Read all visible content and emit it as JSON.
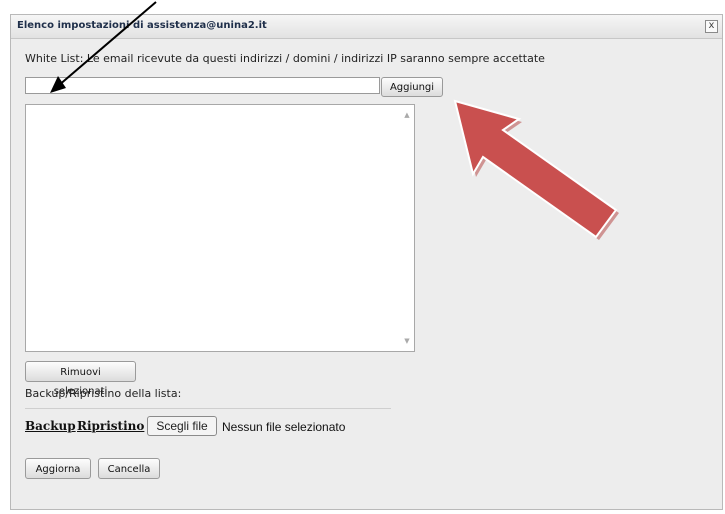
{
  "dialog": {
    "title": "Elenco impostazioni di assistenza@unina2.it",
    "close_label": "x"
  },
  "whitelist": {
    "description": "White List: Le email ricevute da questi indirizzi / domini / indirizzi IP saranno sempre accettate",
    "input_value": "",
    "add_label": "Aggiungi"
  },
  "list": {
    "items": []
  },
  "remove_label": "Rimuovi selezionati",
  "backup": {
    "title": "Backup/Ripristino della lista:",
    "backup_link": "Backup",
    "restore_link": "Ripristino",
    "choose_file_label": "Scegli file",
    "file_status": "Nessun file selezionato"
  },
  "footer": {
    "update_label": "Aggiorna",
    "cancel_label": "Cancella"
  },
  "colors": {
    "annotation_arrow": "#c9504f",
    "pointer_arrow": "#000000"
  }
}
